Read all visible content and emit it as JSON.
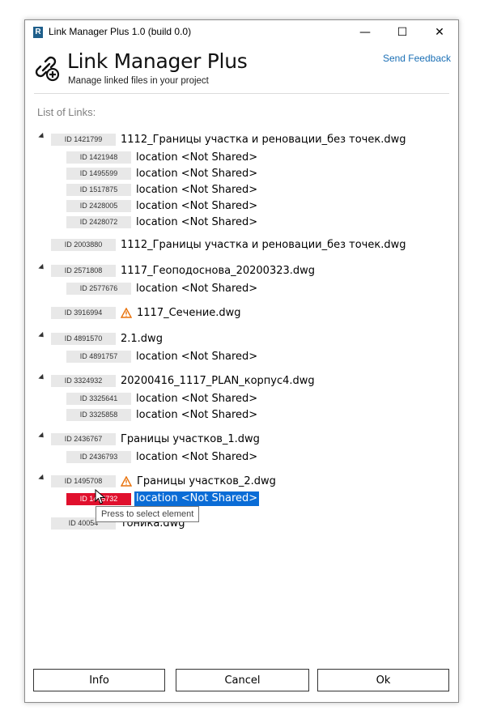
{
  "window": {
    "title": "Link Manager Plus 1.0 (build 0.0)",
    "app_icon": "R"
  },
  "controls": {
    "minimize": "—",
    "maximize": "☐",
    "close": "✕"
  },
  "header": {
    "title": "Link Manager Plus",
    "subtitle": "Manage linked files in your project",
    "feedback": "Send Feedback",
    "icon": "link-add-icon"
  },
  "list_caption": "List of Links:",
  "links": [
    {
      "id": "ID 1421799",
      "name": "1112_Границы участка и реновации_без точек.dwg",
      "expanded": true,
      "warning": false,
      "children": [
        {
          "id": "ID 1421948",
          "name": "location <Not Shared>"
        },
        {
          "id": "ID 1495599",
          "name": "location <Not Shared>"
        },
        {
          "id": "ID 1517875",
          "name": "location <Not Shared>"
        },
        {
          "id": "ID 2428005",
          "name": "location <Not Shared>"
        },
        {
          "id": "ID 2428072",
          "name": "location <Not Shared>"
        }
      ]
    },
    {
      "id": "ID 2003880",
      "name": "1112_Границы участка и реновации_без точек.dwg",
      "expanded": false,
      "warning": false,
      "children": []
    },
    {
      "id": "ID 2571808",
      "name": "1117_Геоподоснова_20200323.dwg",
      "expanded": true,
      "warning": false,
      "children": [
        {
          "id": "ID 2577676",
          "name": "location <Not Shared>"
        }
      ]
    },
    {
      "id": "ID 3916994",
      "name": "1117_Сечение.dwg",
      "expanded": false,
      "warning": true,
      "children": []
    },
    {
      "id": "ID 4891570",
      "name": "2.1.dwg",
      "expanded": true,
      "warning": false,
      "children": [
        {
          "id": "ID 4891757",
          "name": "location <Not Shared>"
        }
      ]
    },
    {
      "id": "ID 3324932",
      "name": "20200416_1117_PLAN_корпус4.dwg",
      "expanded": true,
      "warning": false,
      "children": [
        {
          "id": "ID 3325641",
          "name": "location <Not Shared>"
        },
        {
          "id": "ID 3325858",
          "name": "location <Not Shared>"
        }
      ]
    },
    {
      "id": "ID 2436767",
      "name": "Границы участков_1.dwg",
      "expanded": true,
      "warning": false,
      "children": [
        {
          "id": "ID 2436793",
          "name": "location <Not Shared>"
        }
      ]
    },
    {
      "id": "ID 1495708",
      "name": "Границы участков_2.dwg",
      "expanded": true,
      "warning": true,
      "children": [
        {
          "id": "ID 1495732",
          "name": "location <Not Shared>",
          "selected": true
        }
      ]
    },
    {
      "id": "ID 40054",
      "name": "тоника.dwg",
      "expanded": false,
      "warning": false,
      "children": []
    }
  ],
  "tooltip": "Press to select element",
  "buttons": {
    "info": "Info",
    "cancel": "Cancel",
    "ok": "Ok"
  },
  "colors": {
    "accent": "#0a6cd6",
    "error_id": "#e0102d",
    "link": "#1a6fb5",
    "warning": "#e8710a"
  }
}
